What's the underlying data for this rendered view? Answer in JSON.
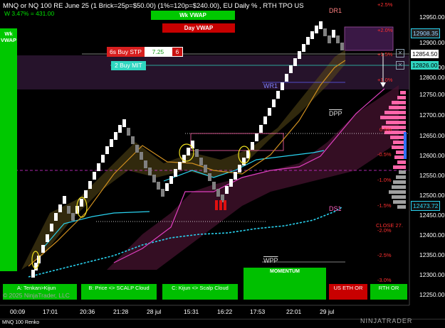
{
  "header": {
    "title": "MNQ or NQ 100 RE June 25 (1 Brick=25p=$50.00) (1%=120p=$240.00), EU Daily % , RTH TPO US",
    "subtitle": "W 3.47% = 431.00",
    "wk_vwap": "Wk VWAP",
    "day_vwap": "Day VWAP",
    "sidebar_label": "Wk VWAP"
  },
  "orders": {
    "stop": {
      "label": "6s Buy STP",
      "price": "7.25",
      "qty": "6"
    },
    "mit": {
      "label": "2 Buy MIT"
    },
    "close_icon": "close-icon"
  },
  "levels": {
    "dr1": "DR1",
    "wr1": "WR1",
    "dpp": "DPP",
    "ds1": "DS1",
    "wpp": "WPP"
  },
  "percent_labels": [
    "+2.5%",
    "+2.0%",
    "+1.5%",
    "+1.0%",
    "0.5%",
    "-0.5%",
    "-1.0%",
    "-1.5%",
    "-2.0%",
    "-2.5%",
    "-3.0%"
  ],
  "close_label": "CLOSE 27.",
  "buttons": {
    "kijun": "A: Tenkan>Kijun",
    "scalp": "B: Price <> SCALP Cloud",
    "kijun_scalp": "C: Kijun <> Scalp Cloud",
    "momentum": "MOMENTUM",
    "us_eth": "US ETH OR",
    "rth": "RTH OR"
  },
  "copyright": "© 2025 NinjaTrader, LLC",
  "logo": "NINJATRADER",
  "instrument": "MNQ 100 Renko",
  "price_axis": {
    "labels": [
      "12950.00",
      "12900.00",
      "12850.00",
      "12800.00",
      "12750.00",
      "12700.00",
      "12650.00",
      "12600.00",
      "12550.00",
      "12500.00",
      "12450.00",
      "12400.00",
      "12350.00",
      "12300.00",
      "12250.00"
    ],
    "tag_top": "12908.35",
    "tag_last": "12854.50",
    "tag_green": "12826.00",
    "tag_low": "12473.72"
  },
  "time_axis": [
    "00:09",
    "17:01",
    "20:36",
    "21:28",
    "28 jul",
    "15:31",
    "16:22",
    "17:53",
    "22:01",
    "29 jul"
  ],
  "colors": {
    "up_brick": "#ffffff",
    "down_brick": "#808080",
    "accent_green": "#00c800",
    "accent_red": "#c80000",
    "cyan": "#29d3f0",
    "magenta": "#e040c0"
  }
}
